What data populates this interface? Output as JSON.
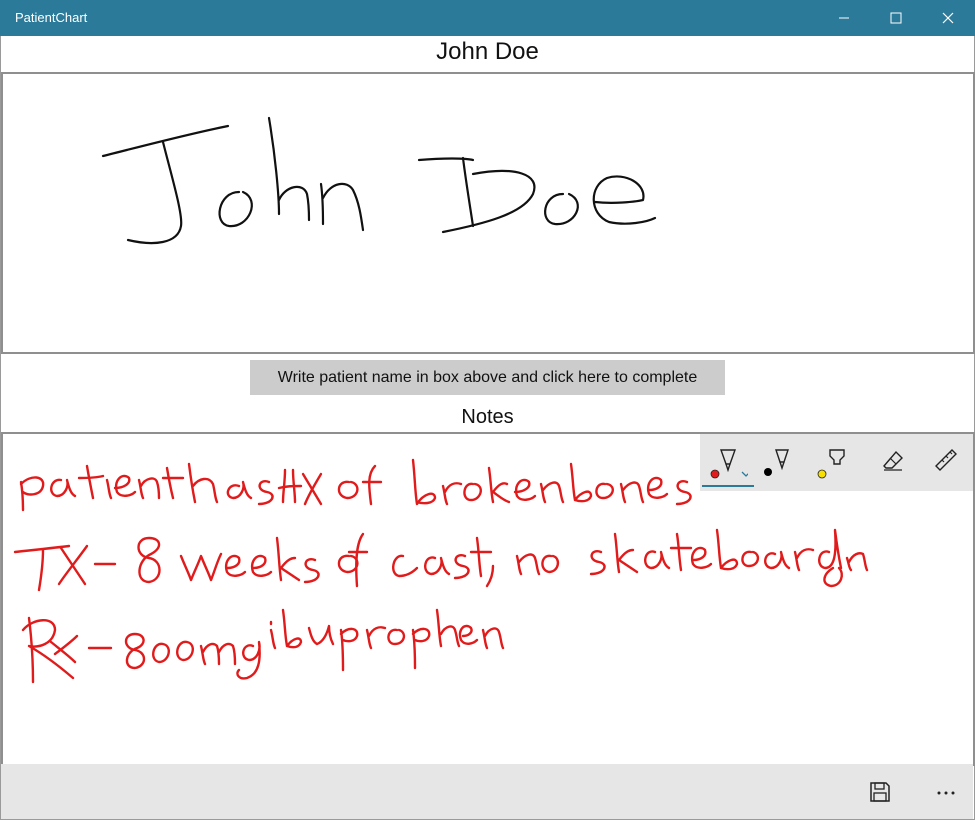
{
  "window": {
    "title": "PatientChart",
    "accent_color": "#2b7a99"
  },
  "patient": {
    "name_heading": "John Doe",
    "handwritten_name": "John Doe"
  },
  "complete_button": {
    "label": "Write patient name in box above and click here to complete"
  },
  "notes": {
    "heading": "Notes",
    "ink_color": "#e11b1b",
    "handwritten_lines": [
      "patient has HX of broken bones",
      "TX - 8 weeks of cast, no skateboarding",
      "Rx - 800mg ibuprophen"
    ]
  },
  "ink_toolbar": {
    "tools": [
      {
        "name": "ballpoint-pen",
        "color": "#e11b1b",
        "selected": true
      },
      {
        "name": "pencil",
        "color": "#000000",
        "selected": false
      },
      {
        "name": "highlighter",
        "color": "#f7e000",
        "selected": false
      },
      {
        "name": "eraser",
        "selected": false
      },
      {
        "name": "ruler",
        "selected": false
      }
    ]
  },
  "command_bar": {
    "save_icon": "save-icon",
    "more_icon": "more-icon"
  }
}
